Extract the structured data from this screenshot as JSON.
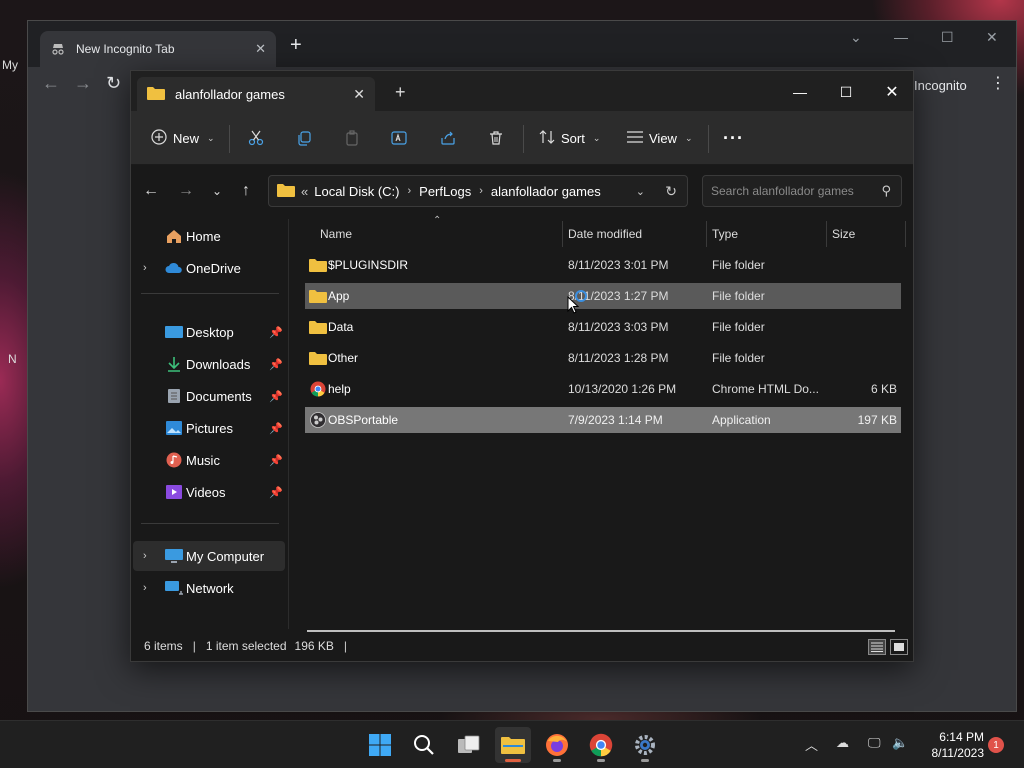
{
  "desktop": {
    "labels": [
      "My",
      "N"
    ]
  },
  "chrome": {
    "tab_title": "New Incognito Tab",
    "incognito_label": "Incognito"
  },
  "explorer": {
    "tab_title": "alanfollador games",
    "toolbar": {
      "new_label": "New",
      "sort_label": "Sort",
      "view_label": "View"
    },
    "address": {
      "overflow": "«",
      "crumbs": [
        "Local Disk (C:)",
        "PerfLogs",
        "alanfollador games"
      ]
    },
    "search_placeholder": "Search alanfollador games",
    "sidebar": {
      "items": [
        {
          "label": "Home",
          "icon": "home-icon"
        },
        {
          "label": "OneDrive",
          "icon": "cloud-icon"
        },
        {
          "label": "Desktop",
          "icon": "desktop-icon",
          "pinned": true
        },
        {
          "label": "Downloads",
          "icon": "download-icon",
          "pinned": true
        },
        {
          "label": "Documents",
          "icon": "document-icon",
          "pinned": true
        },
        {
          "label": "Pictures",
          "icon": "picture-icon",
          "pinned": true
        },
        {
          "label": "Music",
          "icon": "music-icon",
          "pinned": true
        },
        {
          "label": "Videos",
          "icon": "video-icon",
          "pinned": true
        },
        {
          "label": "My Computer",
          "icon": "computer-icon"
        },
        {
          "label": "Network",
          "icon": "network-icon"
        }
      ]
    },
    "columns": [
      "Name",
      "Date modified",
      "Type",
      "Size"
    ],
    "files": [
      {
        "name": "$PLUGINSDIR",
        "date": "8/11/2023 3:01 PM",
        "type": "File folder",
        "size": "",
        "icon": "folder-icon"
      },
      {
        "name": "App",
        "date": "8/11/2023 1:27 PM",
        "type": "File folder",
        "size": "",
        "icon": "folder-icon"
      },
      {
        "name": "Data",
        "date": "8/11/2023 3:03 PM",
        "type": "File folder",
        "size": "",
        "icon": "folder-icon"
      },
      {
        "name": "Other",
        "date": "8/11/2023 1:28 PM",
        "type": "File folder",
        "size": "",
        "icon": "folder-icon"
      },
      {
        "name": "help",
        "date": "10/13/2020 1:26 PM",
        "type": "Chrome HTML Do...",
        "size": "6 KB",
        "icon": "chrome-icon"
      },
      {
        "name": "OBSPortable",
        "date": "7/9/2023 1:14 PM",
        "type": "Application",
        "size": "197 KB",
        "icon": "obs-icon"
      }
    ],
    "status": {
      "items": "6 items",
      "selected": "1 item selected",
      "selected_size": "196 KB"
    }
  },
  "taskbar": {
    "time": "6:14 PM",
    "date": "8/11/2023",
    "notification_count": "1"
  },
  "colors": {
    "selection": "#777777",
    "hover": "#5a5a5a",
    "folder": "#f0c040",
    "accent": "#3b8fe0"
  }
}
